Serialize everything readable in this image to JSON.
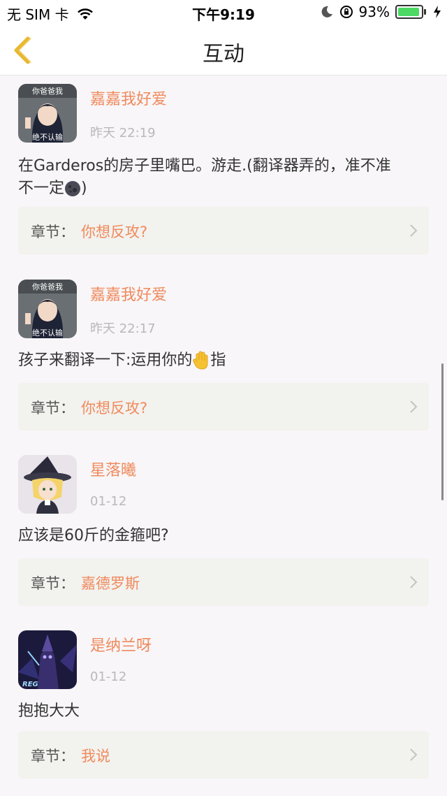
{
  "status_bar": {
    "carrier": "无 SIM 卡",
    "time": "下午9:19",
    "battery": "93%",
    "battery_level": 0.93,
    "icons": [
      "wifi-icon",
      "moon-icon",
      "orientation-lock-icon",
      "battery-icon",
      "charging-bolt-icon"
    ]
  },
  "nav": {
    "title": "互动",
    "back_icon": "chevron-left-icon"
  },
  "colors": {
    "accent": "#f08a5d",
    "back_arrow": "#e8b830",
    "card_bg": "#f2f2ee",
    "page_bg": "#f8f6f8"
  },
  "comments": [
    {
      "user": "嘉嘉我好爱",
      "time": "昨天 22:19",
      "text_line1": "在Garderos的房子里嘴巴。游走.(翻译器弄的，准不准",
      "text_line2_before": "不一定",
      "text_line2_after": ")",
      "emoji": "dark-moon-emoji",
      "chapter_label": "章节：",
      "chapter": "你想反攻?"
    },
    {
      "user": "嘉嘉我好爱",
      "time": "昨天 22:17",
      "text_before": "孩子来翻译一下:运用你的",
      "text_after": "指",
      "emoji": "raised-hand-emoji",
      "chapter_label": "章节：",
      "chapter": "你想反攻?"
    },
    {
      "user": "星落曦",
      "time": "01-12",
      "text": "应该是60斤的金箍吧?",
      "chapter_label": "章节：",
      "chapter": "嘉德罗斯"
    },
    {
      "user": "是纳兰呀",
      "time": "01-12",
      "text": "抱抱大大",
      "chapter_label": "章节：",
      "chapter": "我说"
    }
  ],
  "avatar_texts": {
    "top": "你爸爸我",
    "bottom": "绝不认输",
    "badge": "REG"
  }
}
